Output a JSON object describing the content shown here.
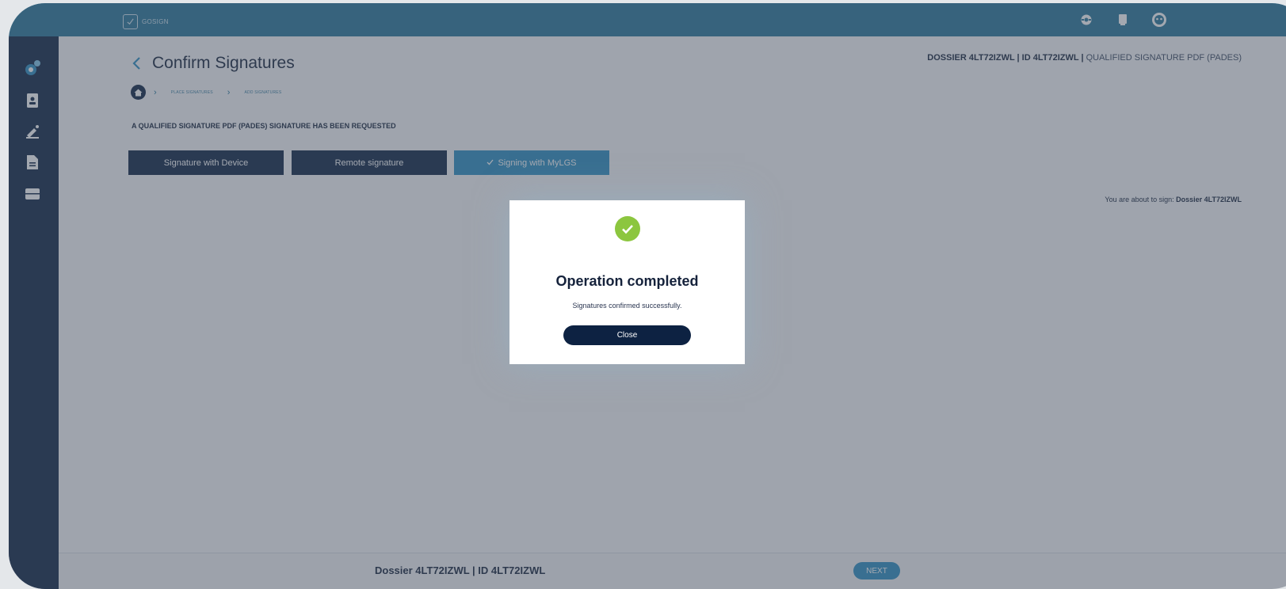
{
  "app": {
    "logo_text": "GOSIGN"
  },
  "header": {
    "page_title": "Confirm Signatures",
    "dossier_label": "DOSSIER 4LT72IZWL | ID 4LT72IZWL",
    "separator": " | ",
    "signature_type": "QUALIFIED SIGNATURE PDF (PADES)"
  },
  "breadcrumb": {
    "items": [
      "PLACE SIGNATURES",
      "ADD SIGNATURES"
    ]
  },
  "request_note": "A QUALIFIED SIGNATURE PDF (PADES) SIGNATURE HAS BEEN REQUESTED",
  "signature_options": {
    "device": "Signature with Device",
    "remote": "Remote signature",
    "mylgs": "Signing with MyLGS",
    "selected": "mylgs"
  },
  "about_to_sign": {
    "prefix": "You are about to sign: ",
    "document": "Dossier 4LT72IZWL"
  },
  "footer": {
    "dossier_text": "Dossier 4LT72IZWL | ID 4LT72IZWL",
    "next_label": "NEXT"
  },
  "modal": {
    "title": "Operation completed",
    "message": "Signatures confirmed successfully.",
    "close_label": "Close"
  },
  "sidebar": {
    "icons": [
      "settings-icon",
      "contacts-icon",
      "sign-icon",
      "document-icon",
      "archive-icon"
    ]
  },
  "topbar": {
    "icons": [
      "support-icon",
      "book-icon",
      "user-icon"
    ]
  },
  "colors": {
    "topbar": "#267599",
    "sidebar": "#0d2242",
    "primary_button": "#0d2242",
    "accent_button": "#2b8cc0",
    "success": "#8cc63f"
  }
}
